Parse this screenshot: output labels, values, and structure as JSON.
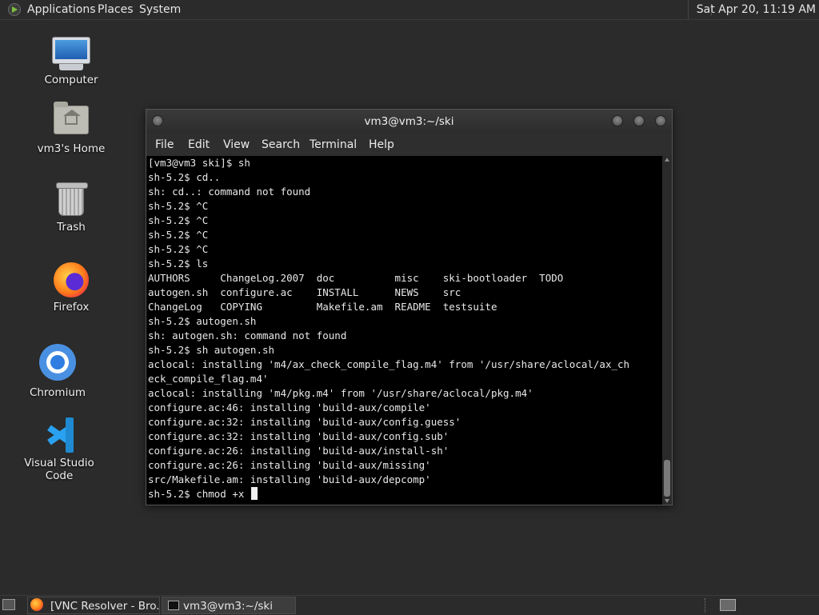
{
  "top_panel": {
    "menus": [
      "Applications",
      "Places",
      "System"
    ],
    "clock": "Sat Apr 20, 11:19 AM"
  },
  "desktop_icons": {
    "computer": "Computer",
    "home": "vm3's Home",
    "trash": "Trash",
    "firefox": "Firefox",
    "chromium": "Chromium",
    "vscode": "Visual Studio Code"
  },
  "terminal": {
    "title": "vm3@vm3:~/ski",
    "menu": [
      "File",
      "Edit",
      "View",
      "Search",
      "Terminal",
      "Help"
    ],
    "lines": [
      "[vm3@vm3 ski]$ sh",
      "sh-5.2$ cd..",
      "sh: cd..: command not found",
      "sh-5.2$ ^C",
      "sh-5.2$ ^C",
      "sh-5.2$ ^C",
      "sh-5.2$ ^C",
      "sh-5.2$ ls",
      "AUTHORS     ChangeLog.2007  doc          misc    ski-bootloader  TODO",
      "autogen.sh  configure.ac    INSTALL      NEWS    src",
      "ChangeLog   COPYING         Makefile.am  README  testsuite",
      "sh-5.2$ autogen.sh",
      "sh: autogen.sh: command not found",
      "sh-5.2$ sh autogen.sh",
      "aclocal: installing 'm4/ax_check_compile_flag.m4' from '/usr/share/aclocal/ax_ch",
      "eck_compile_flag.m4'",
      "aclocal: installing 'm4/pkg.m4' from '/usr/share/aclocal/pkg.m4'",
      "configure.ac:46: installing 'build-aux/compile'",
      "configure.ac:32: installing 'build-aux/config.guess'",
      "configure.ac:32: installing 'build-aux/config.sub'",
      "configure.ac:26: installing 'build-aux/install-sh'",
      "configure.ac:26: installing 'build-aux/missing'",
      "src/Makefile.am: installing 'build-aux/depcomp'"
    ],
    "prompt_line": "sh-5.2$ chmod +x "
  },
  "taskbar": {
    "tasks": [
      "[VNC Resolver - Bro...",
      "vm3@vm3:~/ski"
    ]
  }
}
